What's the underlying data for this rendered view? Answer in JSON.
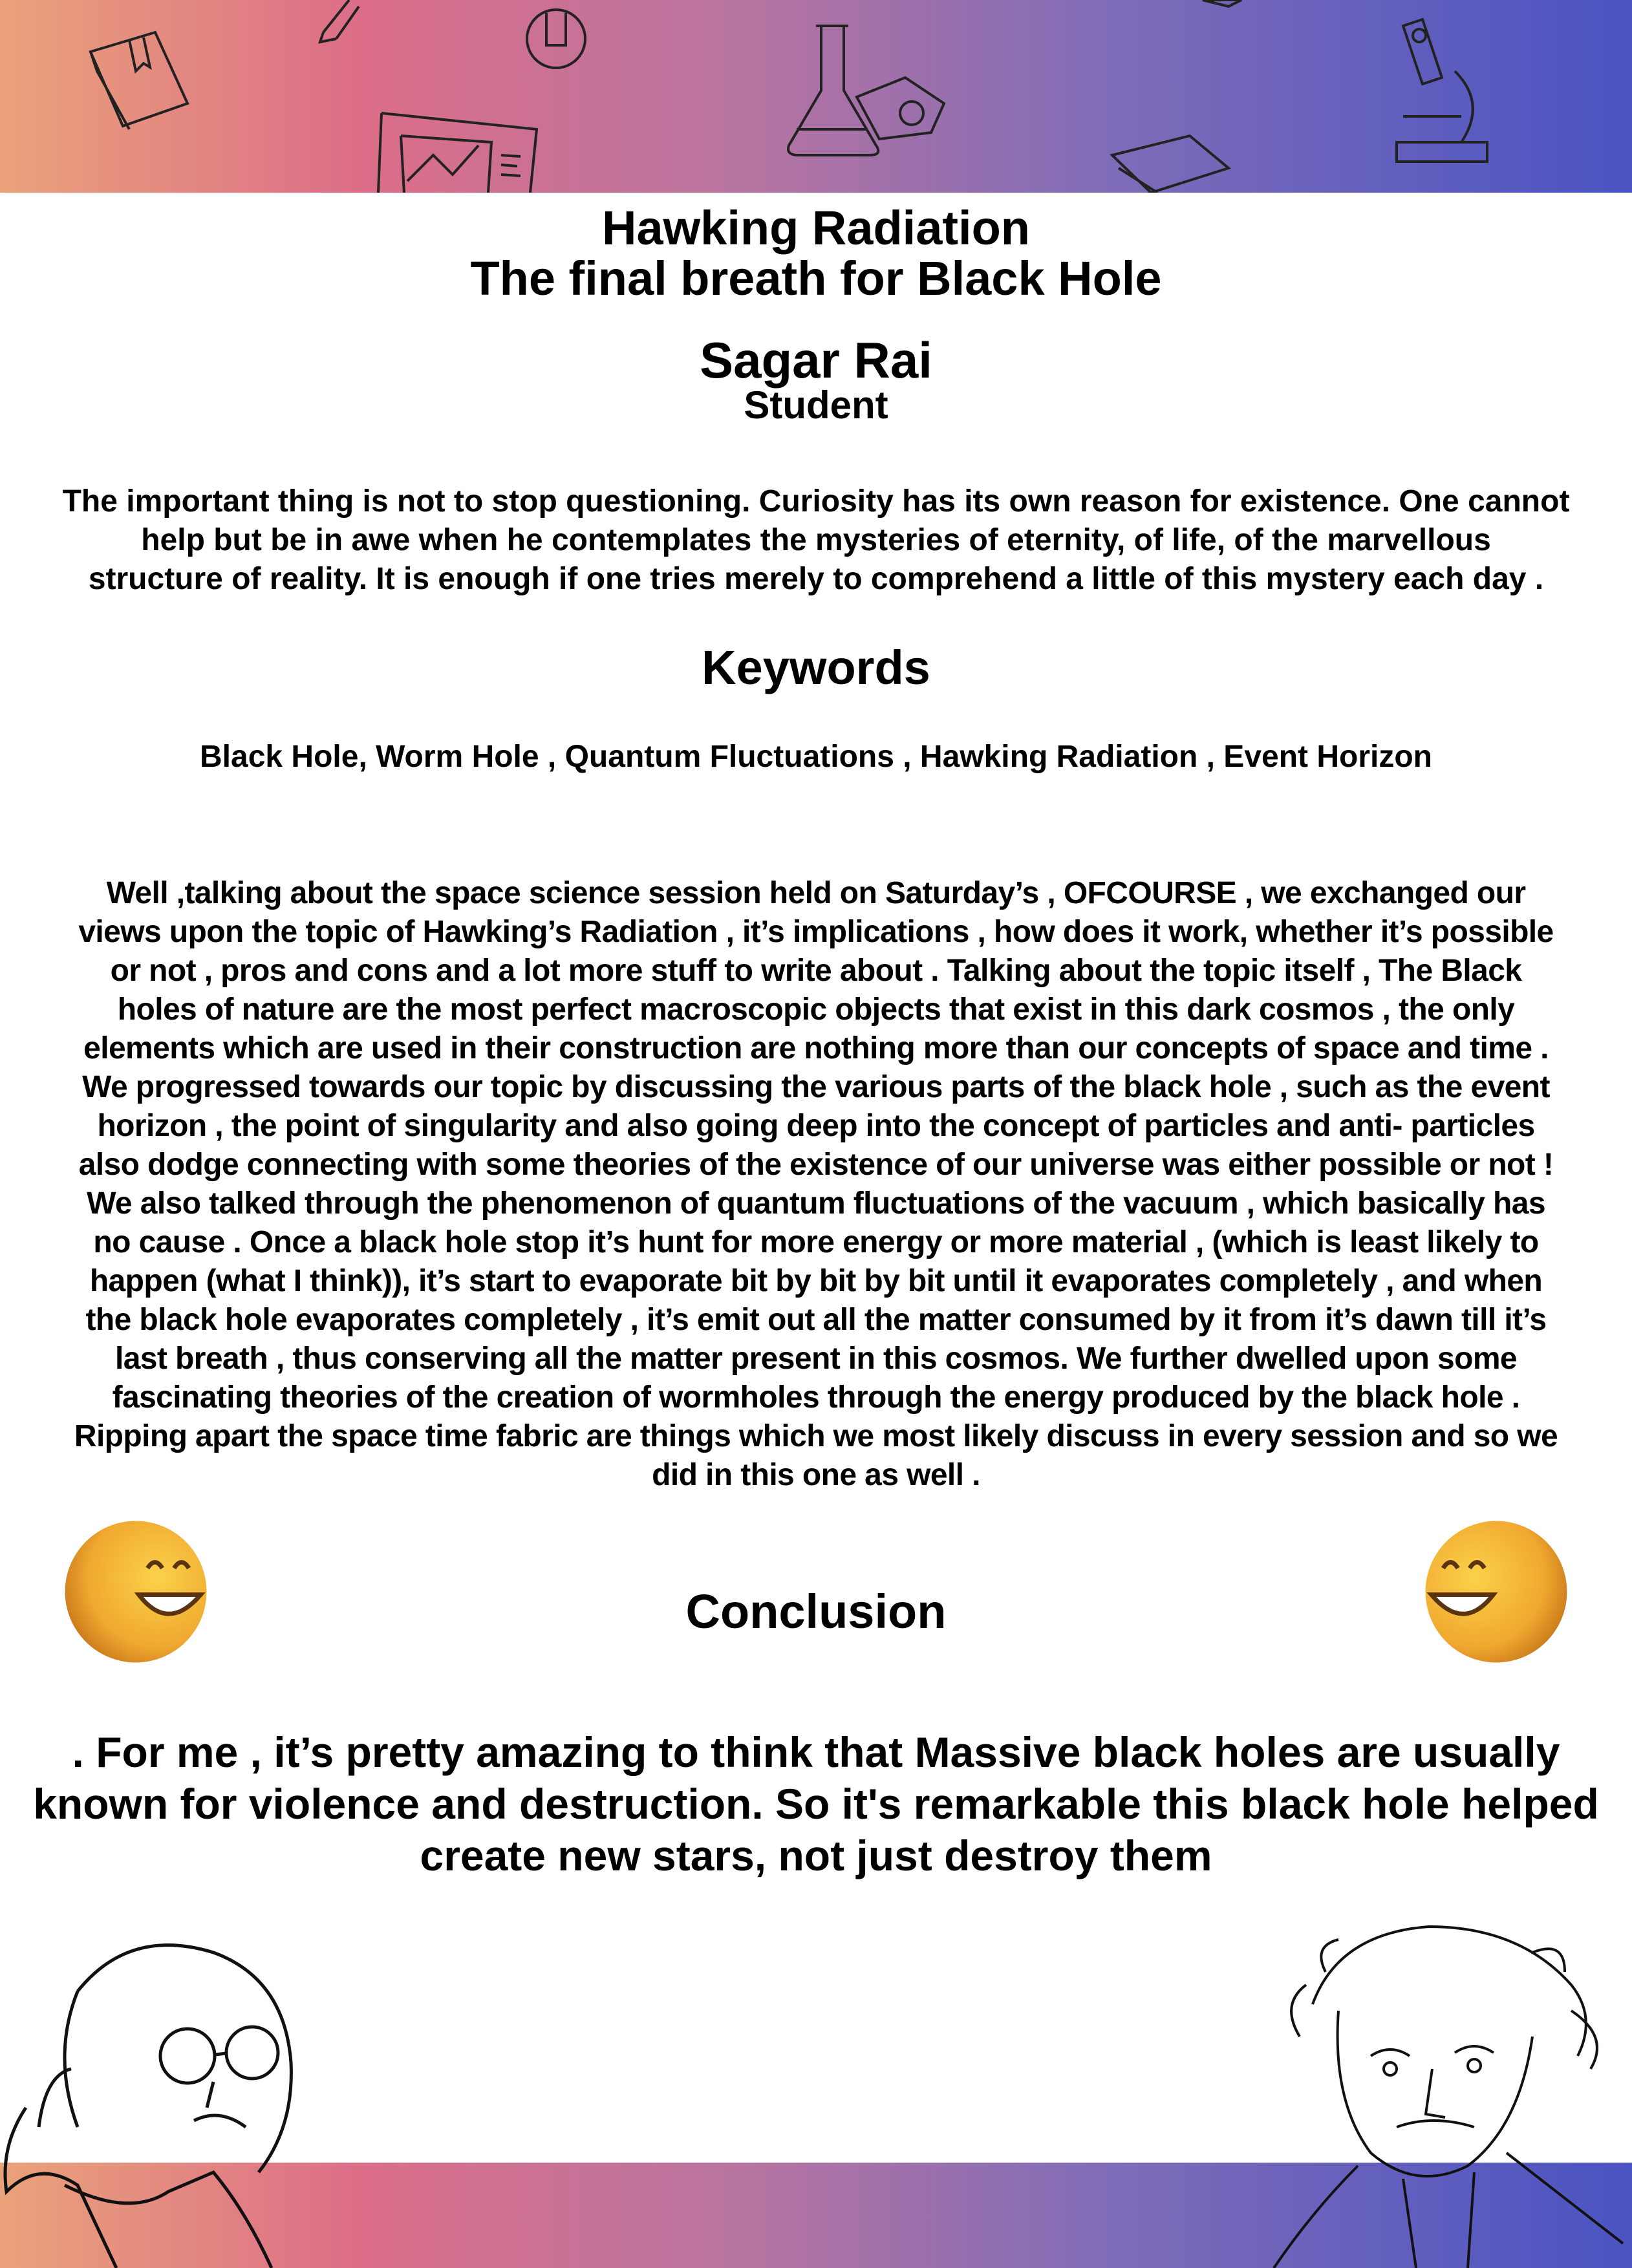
{
  "header": {
    "title_line1": "Hawking Radiation",
    "title_line2": "The final breath for Black Hole",
    "author": "Sagar Rai",
    "role": "Student"
  },
  "quote": {
    "lines": [
      "The important thing is not to stop questioning. Curiosity has its own reason for existence. One cannot",
      "help but be in awe when he contemplates the mysteries of eternity, of life, of the marvellous",
      "structure of reality. It is enough if one tries merely to comprehend a little of this mystery each day ."
    ]
  },
  "keywords": {
    "heading": "Keywords",
    "list": "Black Hole, Worm Hole , Quantum Fluctuations , Hawking Radiation , Event Horizon"
  },
  "body": {
    "lines": [
      "Well ,talking about the space science session held on Saturday’s , OFCOURSE , we exchanged our",
      "views upon the topic of Hawking’s Radiation , it’s implications , how does it work, whether it’s possible",
      "or not , pros and cons and a lot more stuff to write about . Talking about the topic itself ,  The Black",
      "holes of nature are the most perfect macroscopic objects that exist in this dark cosmos , the only",
      "elements which are used in their construction are nothing more than our concepts of space and time .",
      "We progressed towards our topic by discussing the various parts of the black hole , such as the event",
      "horizon , the point of singularity and also going deep into the concept of particles and anti- particles",
      "also dodge connecting with some theories of the existence of our universe was either possible or not !",
      "We also talked through the phenomenon of quantum fluctuations of the vacuum , which basically has",
      "no cause . Once a black hole stop it’s hunt for more energy or more material , (which is least likely to",
      "happen (what I think)), it’s start to evaporate bit by bit by bit until it evaporates completely , and when",
      "the black hole evaporates completely , it’s emit out all the matter consumed by it from it’s dawn till it’s",
      "last breath , thus conserving all the matter present in this cosmos. We further dwelled upon some",
      "fascinating theories of the creation of wormholes through the energy produced by the black hole .",
      "Ripping apart the space time fabric are things which we most likely discuss in every session and so we",
      "did in this one as well ."
    ]
  },
  "conclusion": {
    "heading": "Conclusion",
    "lines": [
      ".    For me , it’s pretty amazing to think that Massive black holes are usually",
      "known for violence and destruction. So it's remarkable this black hole helped",
      "create new stars, not just destroy them"
    ]
  },
  "colors": {
    "gradient_start": "#eaa27a",
    "gradient_mid": "#b874a0",
    "gradient_end": "#4a54c2",
    "emoji": "#f0a830"
  }
}
